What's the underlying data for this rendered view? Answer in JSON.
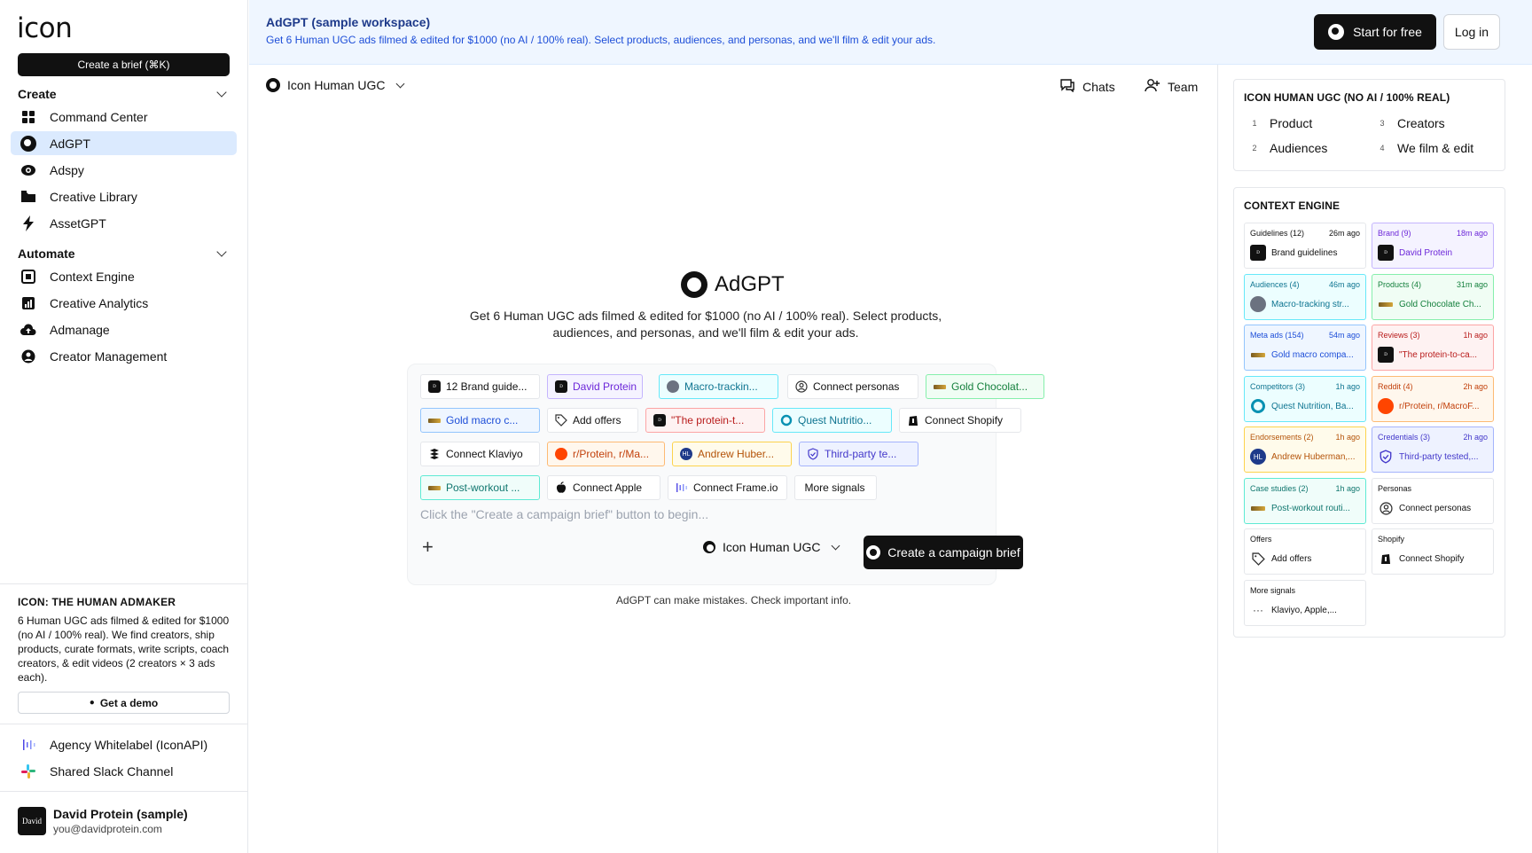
{
  "sidebar": {
    "logo": "icon",
    "create_brief": "Create a brief (⌘K)",
    "sections": [
      {
        "title": "Create",
        "items": [
          "Command Center",
          "AdGPT",
          "Adspy",
          "Creative Library",
          "AssetGPT"
        ]
      },
      {
        "title": "Automate",
        "items": [
          "Context Engine",
          "Creative Analytics",
          "Admanage",
          "Creator Management"
        ]
      }
    ],
    "promo": {
      "title": "ICON: THE HUMAN ADMAKER",
      "text": "6 Human UGC ads filmed & edited for $1000 (no AI / 100% real). We find creators, ship products, curate formats, write scripts, coach creators, & edit videos (2 creators × 3 ads each).",
      "demo_label": "Get a demo"
    },
    "links": [
      "Agency Whitelabel (IconAPI)",
      "Shared Slack Channel"
    ],
    "user": {
      "avatar": "David",
      "name": "David Protein (sample)",
      "email": "you@davidprotein.com"
    }
  },
  "banner": {
    "title": "AdGPT (sample workspace)",
    "subtitle": "Get 6 Human UGC ads filmed & edited for $1000 (no AI / 100% real). Select products, audiences, and personas, and we'll film & edit your ads.",
    "start_label": "Start for free",
    "login_label": "Log in"
  },
  "main": {
    "workspace": "Icon Human UGC",
    "chats_label": "Chats",
    "team_label": "Team",
    "hero_title": "AdGPT",
    "hero_sub": "Get 6 Human UGC ads filmed & edited for $1000 (no AI / 100% real). Select products, audiences, and personas, and we'll film & edit your ads.",
    "chips": [
      "12 Brand guide...",
      "David Protein",
      "Macro-trackin...",
      "Connect personas",
      "Gold Chocolat...",
      "Gold macro c...",
      "Add offers",
      "\"The protein-t...",
      "Quest Nutritio...",
      "Connect Shopify",
      "Connect Klaviyo",
      "r/Protein, r/Ma...",
      "Andrew Huber...",
      "Third-party te...",
      "Post-workout ...",
      "Connect Apple",
      "Connect Frame.io",
      "More signals"
    ],
    "prompt_placeholder": "Click the \"Create a campaign brief\" button to begin...",
    "composer_workspace": "Icon Human UGC",
    "create_label": "Create a campaign brief",
    "disclaimer": "AdGPT can make mistakes. Check important info."
  },
  "right": {
    "panel_title": "ICON HUMAN UGC (NO AI / 100% REAL)",
    "steps": [
      {
        "n": "1",
        "label": "Product"
      },
      {
        "n": "3",
        "label": "Creators"
      },
      {
        "n": "2",
        "label": "Audiences"
      },
      {
        "n": "4",
        "label": "We film & edit"
      }
    ],
    "context_title": "CONTEXT ENGINE",
    "cards": [
      {
        "h": "Guidelines (12)",
        "t": "26m ago",
        "b": "Brand guidelines"
      },
      {
        "h": "Brand (9)",
        "t": "18m ago",
        "b": "David Protein"
      },
      {
        "h": "Audiences (4)",
        "t": "46m ago",
        "b": "Macro-tracking str..."
      },
      {
        "h": "Products (4)",
        "t": "31m ago",
        "b": "Gold Chocolate Ch..."
      },
      {
        "h": "Meta ads (154)",
        "t": "54m ago",
        "b": "Gold macro compa..."
      },
      {
        "h": "Reviews (3)",
        "t": "1h ago",
        "b": "\"The protein-to-ca..."
      },
      {
        "h": "Competitors (3)",
        "t": "1h ago",
        "b": "Quest Nutrition, Ba..."
      },
      {
        "h": "Reddit (4)",
        "t": "2h ago",
        "b": "r/Protein, r/MacroF..."
      },
      {
        "h": "Endorsements (2)",
        "t": "1h ago",
        "b": "Andrew Huberman,..."
      },
      {
        "h": "Credentials (3)",
        "t": "2h ago",
        "b": "Third-party tested,..."
      },
      {
        "h": "Case studies (2)",
        "t": "1h ago",
        "b": "Post-workout routi..."
      },
      {
        "h": "Personas",
        "t": "",
        "b": "Connect personas"
      },
      {
        "h": "Offers",
        "t": "",
        "b": "Add offers"
      },
      {
        "h": "Shopify",
        "t": "",
        "b": "Connect Shopify"
      },
      {
        "h": "More signals",
        "t": "",
        "b": "Klaviyo, Apple,..."
      }
    ]
  },
  "colors": {
    "accent_blue": "#2563eb",
    "purple": "#7c3aed",
    "teal": "#0891b2",
    "green": "#16a34a",
    "red": "#dc2626",
    "orange": "#ea580c",
    "amber": "#d97706",
    "indigo": "#4f46e5"
  }
}
